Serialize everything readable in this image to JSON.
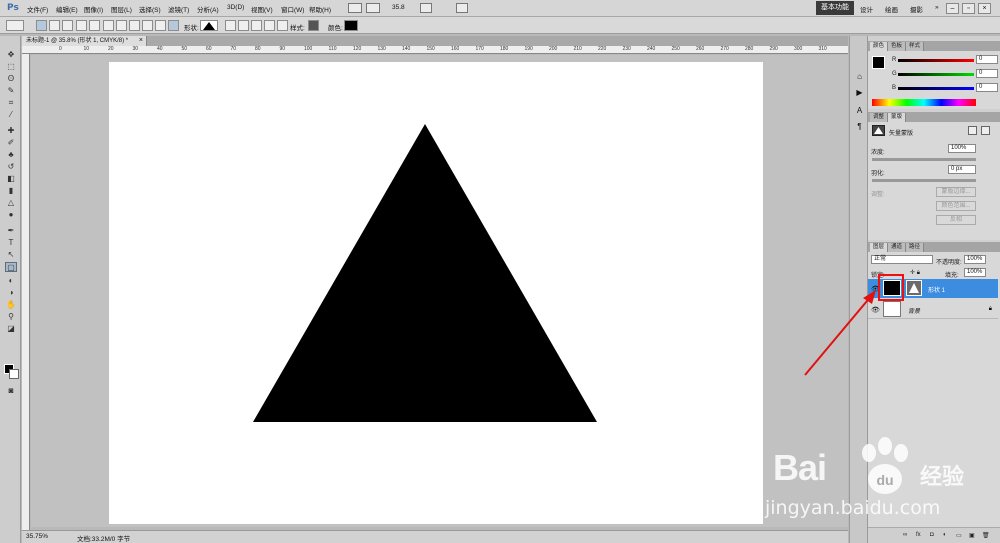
{
  "app": {
    "logo": "Ps"
  },
  "menu": [
    "文件(F)",
    "编辑(E)",
    "图像(I)",
    "图层(L)",
    "选择(S)",
    "滤镜(T)",
    "分析(A)",
    "3D(D)",
    "视图(V)",
    "窗口(W)",
    "帮助(H)"
  ],
  "menubar": {
    "zoom_value": "35.8"
  },
  "workspace": {
    "active": "基本功能",
    "items": [
      "设计",
      "绘画",
      "摄影"
    ]
  },
  "options_bar": {
    "shape_label": "形状:",
    "style_label": "样式:",
    "color_label": "颜色:"
  },
  "document": {
    "tab_title": "未标题-1 @ 35.8% (形状 1, CMYK/8) *",
    "close": "×"
  },
  "rulers": {
    "h_ticks": [
      "0",
      "10",
      "20",
      "30",
      "40",
      "50",
      "60",
      "70",
      "80",
      "90",
      "100",
      "110",
      "120",
      "130",
      "140",
      "150",
      "160",
      "170",
      "180",
      "190",
      "200",
      "210",
      "220",
      "230",
      "240",
      "250",
      "260",
      "270",
      "280",
      "290",
      "300",
      "310"
    ]
  },
  "status": {
    "zoom": "35.75%",
    "doc_info": "文档:33.2M/0 字节"
  },
  "color_panel": {
    "tabs": [
      "颜色",
      "色板",
      "样式"
    ],
    "channels": [
      {
        "label": "R",
        "value": "0"
      },
      {
        "label": "G",
        "value": "0"
      },
      {
        "label": "B",
        "value": "0"
      }
    ]
  },
  "mask_panel": {
    "tabs": [
      "调整",
      "蒙版"
    ],
    "mask_type": "矢量蒙版",
    "density_label": "浓度:",
    "density_value": "100%",
    "feather_label": "羽化:",
    "feather_value": "0 px",
    "refine_label": "调整:",
    "buttons": [
      "蒙版边缘...",
      "颜色范围...",
      "反相"
    ]
  },
  "layers_panel": {
    "tabs": [
      "图层",
      "通道",
      "路径"
    ],
    "blend_mode": "正常",
    "opacity_label": "不透明度:",
    "opacity_value": "100%",
    "lock_label": "锁定:",
    "fill_label": "填充:",
    "fill_value": "100%",
    "layers": [
      {
        "name": "形状 1",
        "selected": true
      },
      {
        "name": "背景",
        "selected": false
      }
    ]
  },
  "watermark": {
    "brand": "Bai",
    "sub": "经验",
    "url": "jingyan.baidu.com"
  },
  "colors": {
    "highlight": "#e11111",
    "selection": "#3c8ddf",
    "accent": "#3e6fa8"
  }
}
